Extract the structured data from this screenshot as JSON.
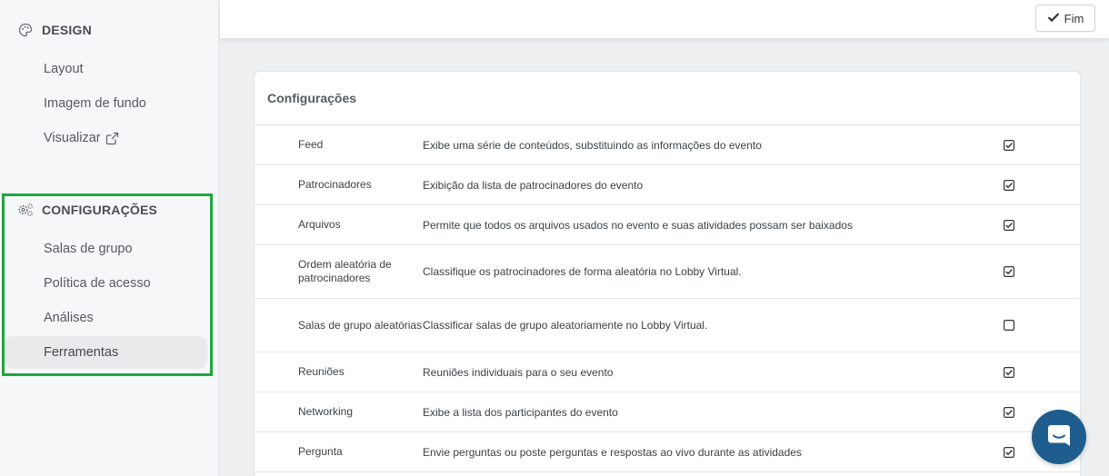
{
  "sidebar": {
    "design_header": "DESIGN",
    "design_items": [
      {
        "label": "Layout"
      },
      {
        "label": "Imagem de fundo"
      },
      {
        "label": "Visualizar"
      }
    ],
    "config_header": "CONFIGURAÇÕES",
    "config_items": [
      {
        "label": "Salas de grupo"
      },
      {
        "label": "Política de acesso"
      },
      {
        "label": "Análises"
      },
      {
        "label": "Ferramentas",
        "active": true
      }
    ]
  },
  "topbar": {
    "finish_label": "Fim"
  },
  "card": {
    "title": "Configurações",
    "rows": [
      {
        "name": "Feed",
        "description": "Exibe uma série de conteúdos, substituindo as informações do evento",
        "checked": true
      },
      {
        "name": "Patrocinadores",
        "description": "Exibição da lista de patrocinadores do evento",
        "checked": true
      },
      {
        "name": "Arquivos",
        "description": "Permite que todos os arquivos usados no evento e suas atividades possam ser baixados",
        "checked": true
      },
      {
        "name": "Ordem aleatória de patrocinadores",
        "description": "Classifique os patrocinadores de forma aleatória no Lobby Virtual.",
        "checked": true
      },
      {
        "name": "Salas de grupo aleatórias",
        "description": "Classificar salas de grupo aleatoriamente no Lobby Virtual.",
        "checked": false
      },
      {
        "name": "Reuniões",
        "description": "Reuniões individuais para o seu evento",
        "checked": true
      },
      {
        "name": "Networking",
        "description": "Exibe a lista dos participantes do evento",
        "checked": true
      },
      {
        "name": "Pergunta",
        "description": "Envie perguntas ou poste perguntas e respostas ao vivo durante as atividades",
        "checked": true
      }
    ]
  },
  "colors": {
    "highlight": "#21a53d",
    "chat": "#1f5d8e"
  }
}
